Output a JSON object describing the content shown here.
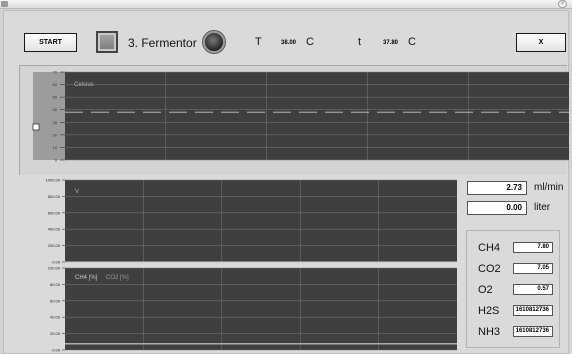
{
  "toolbar": {
    "start_label": "START",
    "title": "3. Fermentor",
    "temp_label": "T",
    "temp_value": "38.00",
    "temp_unit": "C",
    "temp2_label": "t",
    "temp2_value": "37.80",
    "temp2_unit": "C",
    "close_label": "X"
  },
  "readouts": {
    "flow_value": "2.73",
    "flow_unit": "ml/min",
    "volume_value": "0.00",
    "volume_unit": "liter"
  },
  "gases": [
    {
      "name": "CH4",
      "value": "7.80"
    },
    {
      "name": "CO2",
      "value": "7.05"
    },
    {
      "name": "O2",
      "value": "0.57"
    },
    {
      "name": "H2S",
      "value": "1610812736"
    },
    {
      "name": "NH3",
      "value": "1610812736"
    }
  ],
  "colors": {
    "plot_bg": "#3f3f3f",
    "grid": "#7a7a7a",
    "trace": "#c8c8c8"
  },
  "chart_data": [
    {
      "type": "line",
      "title": "Celsius",
      "ylabel": "",
      "yticks": [
        "0",
        "10",
        "20",
        "30",
        "40",
        "50",
        "60",
        "70"
      ],
      "ylim": [
        0,
        70
      ],
      "xlim": [
        0,
        10
      ],
      "grid": true,
      "series": [
        {
          "name": "Celsius",
          "x": [
            0,
            10
          ],
          "values": [
            38,
            38
          ],
          "style": "dashed"
        }
      ]
    },
    {
      "type": "line",
      "title": "V",
      "yticks": [
        "0.00",
        "200.00",
        "400.00",
        "600.00",
        "800.00",
        "1000.00"
      ],
      "ylim": [
        0,
        1000
      ],
      "xlim": [
        0,
        10
      ],
      "grid": true,
      "series": [
        {
          "name": "V",
          "x": [
            0,
            10
          ],
          "values": [
            0,
            0
          ]
        }
      ]
    },
    {
      "type": "line",
      "legend": [
        "CH4 [%]",
        "CO2 [%]"
      ],
      "yticks": [
        "0.00",
        "20.00",
        "40.00",
        "60.00",
        "80.00",
        "100.00"
      ],
      "ylim": [
        0,
        100
      ],
      "xlim": [
        0,
        10
      ],
      "grid": true,
      "series": [
        {
          "name": "CH4 [%]",
          "x": [
            0,
            10
          ],
          "values": [
            7.8,
            7.8
          ]
        },
        {
          "name": "CO2 [%]",
          "x": [
            0,
            10
          ],
          "values": [
            7.05,
            7.05
          ]
        }
      ]
    }
  ]
}
